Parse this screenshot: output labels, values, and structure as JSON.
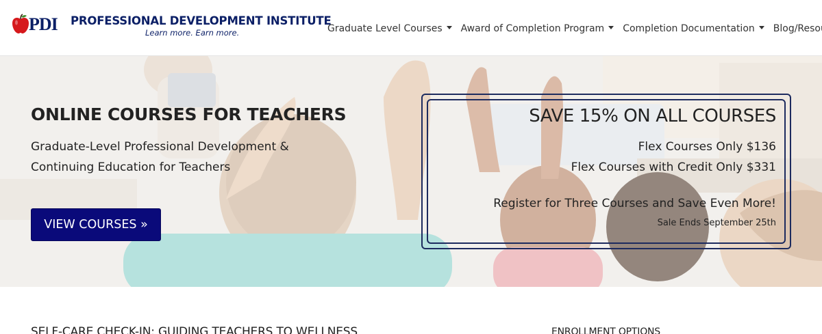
{
  "header": {
    "logo_mark": "PDI",
    "logo_name": "PROFESSIONAL DEVELOPMENT INSTITUTE",
    "logo_tagline": "Learn more. Earn more.",
    "nav": [
      {
        "label": "Graduate Level Courses",
        "has_dropdown": true
      },
      {
        "label": "Award of Completion Program",
        "has_dropdown": true
      },
      {
        "label": "Completion Documentation",
        "has_dropdown": true
      },
      {
        "label": "Blog/Resource",
        "has_dropdown": false
      }
    ]
  },
  "hero": {
    "title": "ONLINE COURSES FOR TEACHERS",
    "subtitle_line1": "Graduate-Level Professional Development &",
    "subtitle_line2": "Continuing Education for Teachers",
    "cta_label": "VIEW COURSES »",
    "promo": {
      "title": "SAVE 15% ON ALL COURSES",
      "line1": "Flex Courses Only $136",
      "line2": "Flex Courses with Credit Only $331",
      "line3": "Register for Three Courses and Save Even More!",
      "note": "Sale Ends September 25th"
    }
  },
  "sections": {
    "left_heading": "SELF-CARE CHECK-IN: GUIDING TEACHERS TO WELLNESS",
    "right_heading": "ENROLLMENT OPTIONS"
  },
  "colors": {
    "brand_navy": "#0b1f66",
    "button_blue": "#0a0a7a",
    "promo_border": "#1c2a5e",
    "apple_red": "#d6191c"
  }
}
